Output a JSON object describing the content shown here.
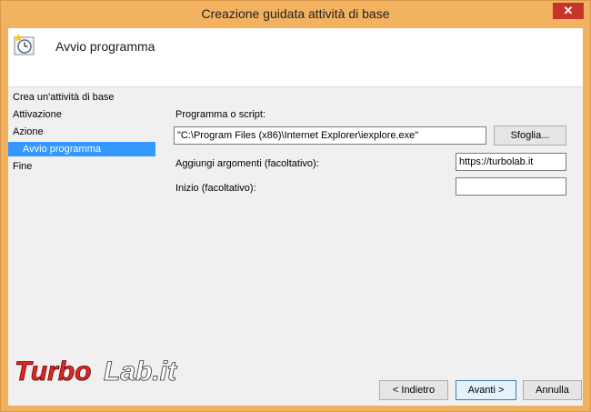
{
  "window": {
    "title": "Creazione guidata attività di base",
    "close_glyph": "✕"
  },
  "header": {
    "title": "Avvio programma",
    "icon": "task-clock-icon"
  },
  "nav": {
    "items": [
      {
        "label": "Crea un'attività di base"
      },
      {
        "label": "Attivazione"
      },
      {
        "label": "Azione"
      },
      {
        "label": "Avvio programma"
      },
      {
        "label": "Fine"
      }
    ]
  },
  "form": {
    "program_label": "Programma o script:",
    "program_value": "\"C:\\Program Files (x86)\\Internet Explorer\\iexplore.exe\"",
    "browse_label": "Sfoglia...",
    "args_label": "Aggiungi argomenti (facoltativo):",
    "args_value": "https://turbolab.it",
    "start_label": "Inizio (facoltativo):",
    "start_value": ""
  },
  "footer": {
    "back_label": "< Indietro",
    "next_label": "Avanti >",
    "cancel_label": "Annulla"
  },
  "watermark": {
    "logo": "TurboLab.it",
    "colors": {
      "turbo": "#e32626",
      "lab": "#ffffff"
    }
  }
}
